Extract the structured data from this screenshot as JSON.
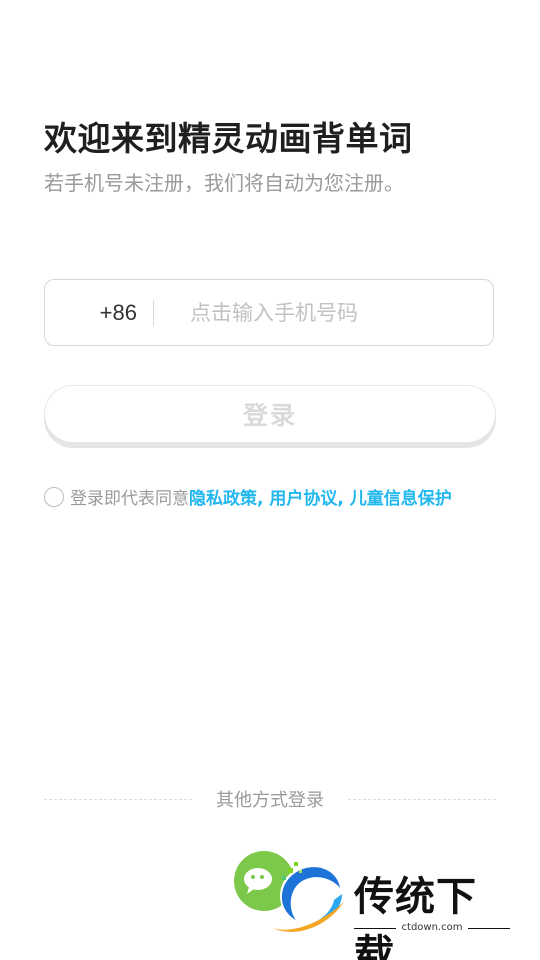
{
  "header": {
    "title": "欢迎来到精灵动画背单词",
    "subtitle": "若手机号未注册，我们将自动为您注册。"
  },
  "phone": {
    "country_code": "+86",
    "placeholder": "点击输入手机号码",
    "value": ""
  },
  "login_button": {
    "label": "登录",
    "enabled": false
  },
  "agreement": {
    "checked": false,
    "prefix": "登录即代表同意",
    "links": "隐私政策, 用户协议, 儿童信息保护",
    "link_color": "#21b7ef"
  },
  "other_login": {
    "label": "其他方式登录",
    "options": [
      "wechat-icon"
    ]
  },
  "watermark": {
    "brand": "传统下载",
    "url": "ctdown.com"
  }
}
